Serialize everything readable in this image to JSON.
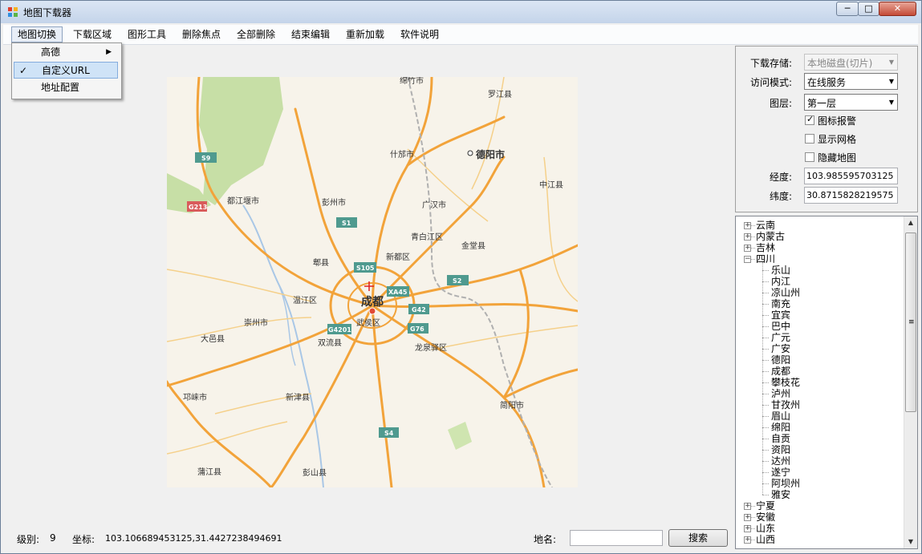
{
  "window": {
    "title": "地图下载器",
    "minimize": "─",
    "maximize": "□",
    "close": "✕"
  },
  "menubar": [
    "地图切换",
    "下载区域",
    "图形工具",
    "删除焦点",
    "全部删除",
    "结束编辑",
    "重新加载",
    "软件说明"
  ],
  "dropdown": {
    "items": [
      {
        "label": "高德",
        "has_submenu": true,
        "checked": false
      },
      {
        "label": "自定义URL",
        "has_submenu": false,
        "checked": true,
        "highlighted": true
      },
      {
        "label": "地址配置",
        "has_submenu": false,
        "checked": false
      }
    ],
    "check_glyph": "✓",
    "submenu_glyph": "▶"
  },
  "map": {
    "labels": [
      "绵竹市",
      "罗江县",
      "什邡市",
      "德阳市",
      "中江县",
      "都江堰市",
      "彭州市",
      "广汉市",
      "青白江区",
      "金堂县",
      "郫县",
      "新都区",
      "温江区",
      "成都",
      "崇州市",
      "大邑县",
      "武侯区",
      "双流县",
      "龙泉驿区",
      "邛崃市",
      "新津县",
      "简阳市",
      "蒲江县",
      "彭山县"
    ],
    "shields": [
      "S9",
      "G213",
      "S1",
      "S105",
      "XA45",
      "S2",
      "G42",
      "G4201",
      "G76",
      "S4"
    ]
  },
  "status": {
    "level_label": "级别:",
    "level_value": "9",
    "coord_label": "坐标:",
    "coord_value": "103.106689453125,31.4427238494691",
    "place_label": "地名:",
    "place_value": "",
    "search_button": "搜索"
  },
  "settings": {
    "storage_label": "下载存储:",
    "storage_value": "本地磁盘(切片)",
    "mode_label": "访问模式:",
    "mode_value": "在线服务",
    "layer_label": "图层:",
    "layer_value": "第一层",
    "icon_alarm_label": "图标报警",
    "icon_alarm_checked": true,
    "show_grid_label": "显示网格",
    "show_grid_checked": false,
    "hide_map_label": "隐藏地图",
    "hide_map_checked": false,
    "lon_label": "经度:",
    "lon_value": "103.985595703125",
    "lat_label": "纬度:",
    "lat_value": "30.8715828219575"
  },
  "tree": {
    "collapsed_before": [
      "云南",
      "内蒙古",
      "吉林"
    ],
    "expanded": "四川",
    "children": [
      "乐山",
      "内江",
      "凉山州",
      "南充",
      "宜宾",
      "巴中",
      "广元",
      "广安",
      "德阳",
      "成都",
      "攀枝花",
      "泸州",
      "甘孜州",
      "眉山",
      "绵阳",
      "自贡",
      "资阳",
      "达州",
      "遂宁",
      "阿坝州",
      "雅安"
    ],
    "collapsed_after": [
      "宁夏",
      "安徽",
      "山东",
      "山西"
    ],
    "plus": "+",
    "minus": "−",
    "scroll_up": "▲",
    "scroll_down": "▼",
    "grip": "≡"
  },
  "colors": {
    "map_bg": "#f7f3ea",
    "road_major": "#f2a33a",
    "road_minor": "#f5d08a",
    "green_area": "#c7dfa6",
    "river": "#a9c7e6",
    "shield": "#4f9a8f",
    "shield_red": "#d95b5b",
    "menu_highlight": "#cfe3f7"
  }
}
